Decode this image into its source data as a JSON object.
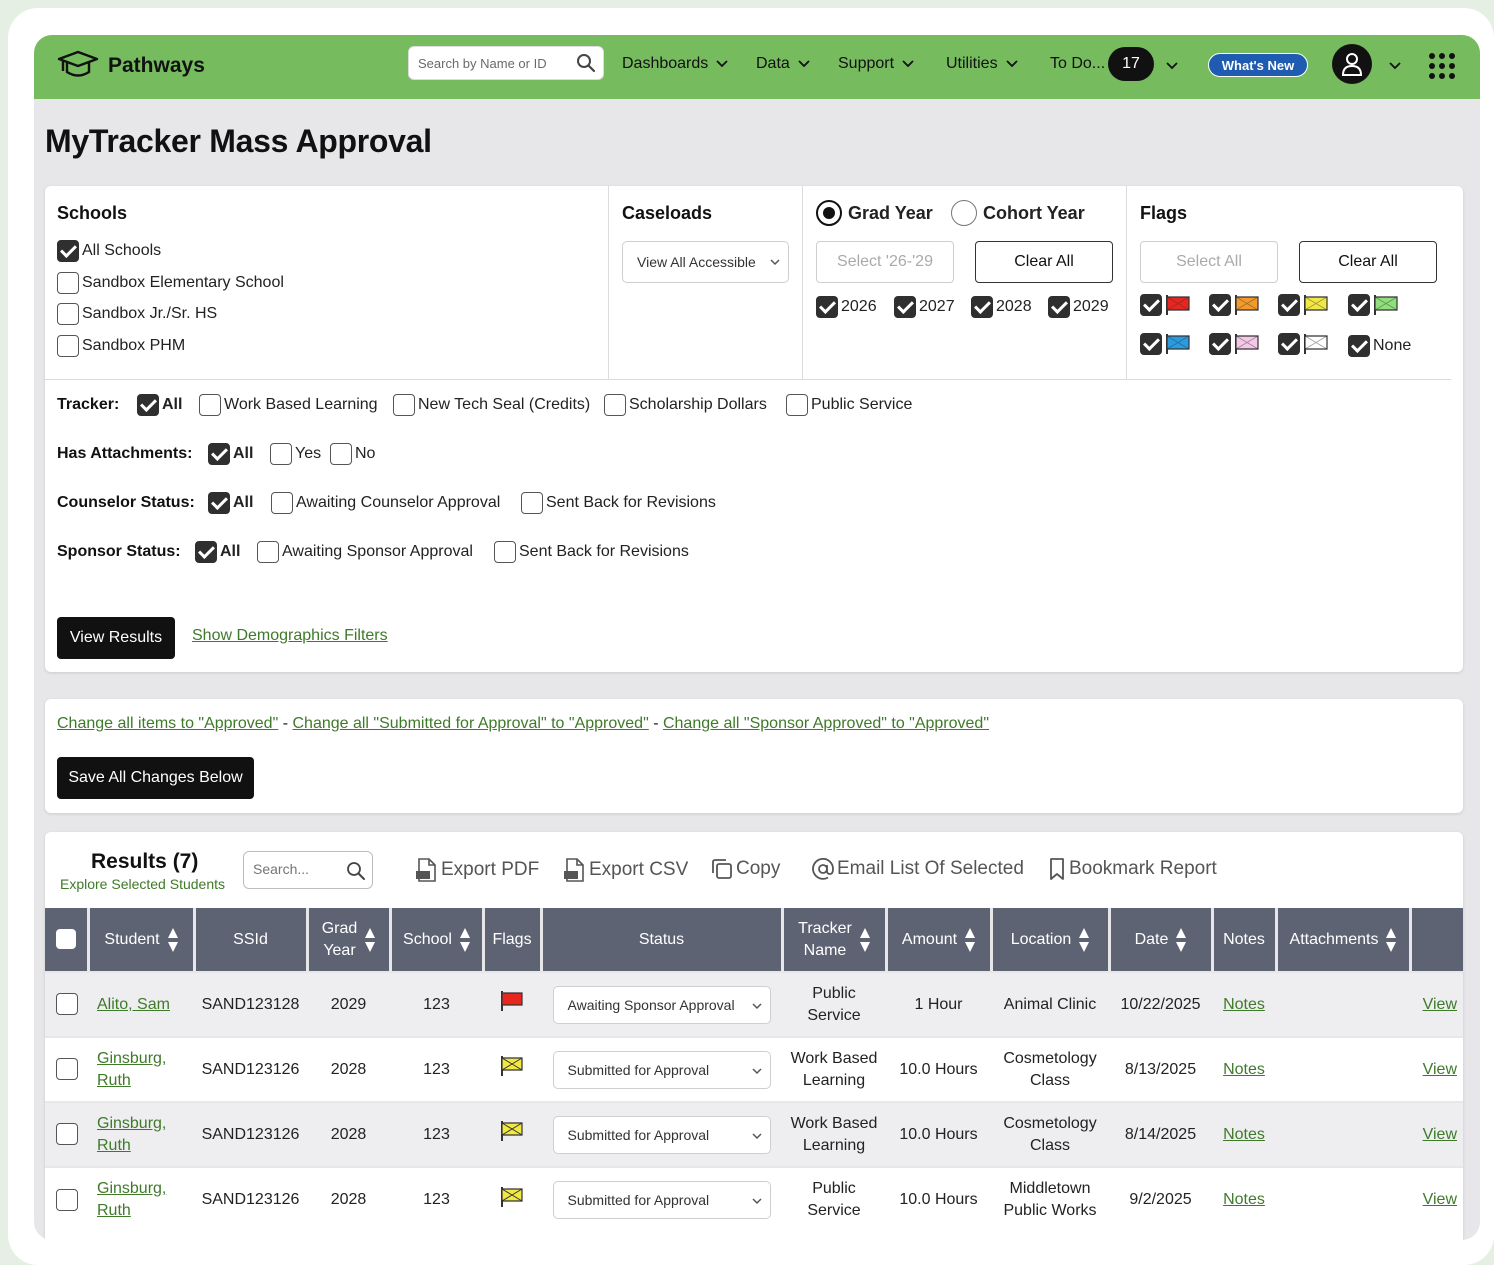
{
  "app": {
    "brand": "Pathways",
    "search_placeholder": "Search by Name or ID",
    "nav": {
      "dashboards": "Dashboards",
      "data": "Data",
      "support": "Support",
      "utilities": "Utilities",
      "todo": "To Do...",
      "todo_count": "17",
      "whats_new": "What's New"
    },
    "accent_color": "#76bb5e",
    "link_color": "#3f7a2a"
  },
  "page_title": "MyTracker Mass Approval",
  "filters": {
    "schools": {
      "title": "Schools",
      "items": [
        {
          "label": "All Schools",
          "checked": true
        },
        {
          "label": "Sandbox Elementary School",
          "checked": false
        },
        {
          "label": "Sandbox Jr./Sr. HS",
          "checked": false
        },
        {
          "label": "Sandbox PHM",
          "checked": false
        }
      ]
    },
    "caseloads": {
      "title": "Caseloads",
      "selected": "View All Accessible"
    },
    "year": {
      "grad_year_label": "Grad Year",
      "cohort_year_label": "Cohort Year",
      "selected": "grad",
      "select_btn": "Select '26-'29",
      "clear_btn": "Clear All",
      "years": [
        {
          "label": "2026",
          "checked": true
        },
        {
          "label": "2027",
          "checked": true
        },
        {
          "label": "2028",
          "checked": true
        },
        {
          "label": "2029",
          "checked": true
        }
      ]
    },
    "flags": {
      "title": "Flags",
      "select_all": "Select All",
      "clear_all": "Clear All",
      "none_label": "None",
      "items": [
        {
          "color": "#e8261f",
          "checked": true
        },
        {
          "color": "#f39a2a",
          "checked": true
        },
        {
          "color": "#f2e844",
          "checked": true
        },
        {
          "color": "#8fe07a",
          "checked": true
        },
        {
          "color": "#2a9be0",
          "checked": true
        },
        {
          "color": "#f6c8e8",
          "checked": true
        },
        {
          "color": "#ffffff",
          "checked": true
        }
      ]
    },
    "tracker": {
      "label": "Tracker:",
      "all": "All",
      "options": [
        "Work Based Learning",
        "New Tech Seal (Credits)",
        "Scholarship Dollars",
        "Public Service"
      ]
    },
    "attachments": {
      "label": "Has Attachments:",
      "all": "All",
      "options": [
        "Yes",
        "No"
      ]
    },
    "counselor": {
      "label": "Counselor Status:",
      "all": "All",
      "options": [
        "Awaiting Counselor Approval",
        "Sent Back for Revisions"
      ]
    },
    "sponsor": {
      "label": "Sponsor Status:",
      "all": "All",
      "options": [
        "Awaiting Sponsor Approval",
        "Sent Back for Revisions"
      ]
    },
    "view_results": "View Results",
    "show_demographics": "Show Demographics Filters"
  },
  "bulk": {
    "link1": "Change all items to \"Approved\"",
    "sep": " - ",
    "link2": "Change all \"Submitted for Approval\" to \"Approved\"",
    "link3": "Change all \"Sponsor Approved\" to \"Approved\"",
    "save": "Save All Changes Below"
  },
  "results": {
    "title": "Results (7)",
    "subtitle": "Explore Selected Students",
    "search_placeholder": "Search...",
    "toolbar": {
      "export_pdf": "Export PDF",
      "export_csv": "Export CSV",
      "copy": "Copy",
      "email": "Email List Of Selected",
      "bookmark": "Bookmark Report"
    },
    "columns": {
      "student": "Student",
      "ssid": "SSId",
      "grad_year_1": "Grad",
      "grad_year_2": "Year",
      "school": "School",
      "flags": "Flags",
      "status": "Status",
      "tracker_1": "Tracker",
      "tracker_2": "Name",
      "amount": "Amount",
      "location": "Location",
      "date": "Date",
      "notes": "Notes",
      "attachments": "Attachments"
    },
    "rows": [
      {
        "student_1": "Alito, Sam",
        "student_2": "",
        "ssid": "SAND123128",
        "grad_year": "2029",
        "school": "123",
        "flag": "#e8261f",
        "status": "Awaiting Sponsor Approval",
        "tracker_1": "Public",
        "tracker_2": "Service",
        "amount": "1 Hour",
        "location_1": "Animal Clinic",
        "location_2": "",
        "date": "10/22/2025",
        "notes": "Notes",
        "view": "View"
      },
      {
        "student_1": "Ginsburg,",
        "student_2": "Ruth",
        "ssid": "SAND123126",
        "grad_year": "2028",
        "school": "123",
        "flag": "#f2e844",
        "status": "Submitted for Approval",
        "tracker_1": "Work Based",
        "tracker_2": "Learning",
        "amount": "10.0 Hours",
        "location_1": "Cosmetology",
        "location_2": "Class",
        "date": "8/13/2025",
        "notes": "Notes",
        "view": "View"
      },
      {
        "student_1": "Ginsburg,",
        "student_2": "Ruth",
        "ssid": "SAND123126",
        "grad_year": "2028",
        "school": "123",
        "flag": "#f2e844",
        "status": "Submitted for Approval",
        "tracker_1": "Work Based",
        "tracker_2": "Learning",
        "amount": "10.0 Hours",
        "location_1": "Cosmetology",
        "location_2": "Class",
        "date": "8/14/2025",
        "notes": "Notes",
        "view": "View"
      },
      {
        "student_1": "Ginsburg,",
        "student_2": "Ruth",
        "ssid": "SAND123126",
        "grad_year": "2028",
        "school": "123",
        "flag": "#f2e844",
        "status": "Submitted for Approval",
        "tracker_1": "Public",
        "tracker_2": "Service",
        "amount": "10.0 Hours",
        "location_1": "Middletown",
        "location_2": "Public Works",
        "date": "9/2/2025",
        "notes": "Notes",
        "view": "View"
      }
    ]
  }
}
